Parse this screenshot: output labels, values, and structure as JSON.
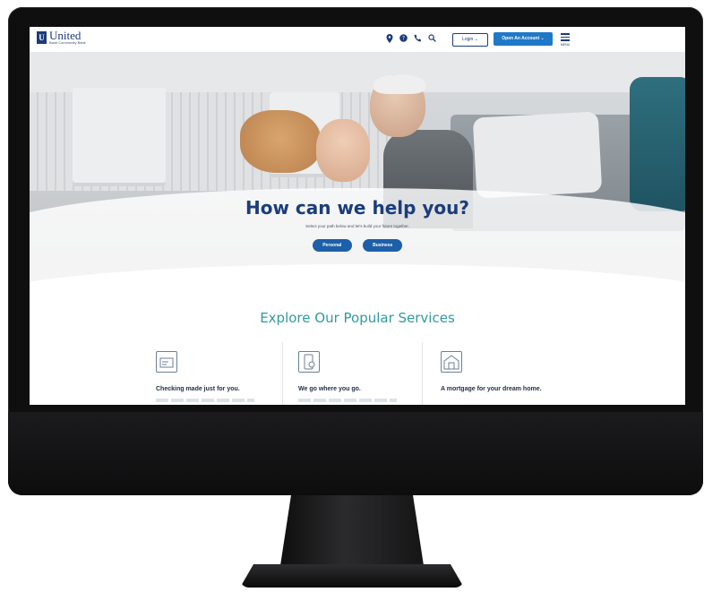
{
  "header": {
    "logo_name": "United",
    "logo_tagline": "Bank  Community Bank",
    "icons": [
      "location-icon",
      "help-icon",
      "phone-icon",
      "search-icon"
    ],
    "login_label": "Login ⌄",
    "open_account_label": "Open An Account ⌄",
    "menu_label": "MENU"
  },
  "hero": {
    "title": "How can we help you?",
    "subtitle": "Select your path below and let's build your future together.",
    "buttons": [
      {
        "label": "Personal"
      },
      {
        "label": "Business"
      }
    ]
  },
  "services": {
    "title": "Explore Our Popular Services",
    "items": [
      {
        "title": "Checking made just for you.",
        "icon": "checking-icon"
      },
      {
        "title": "We go where you go.",
        "icon": "mobile-icon"
      },
      {
        "title": "A mortgage for your dream home.",
        "icon": "home-icon"
      }
    ]
  },
  "colors": {
    "brand_navy": "#1d3a7a",
    "accent_blue": "#1f78c8",
    "teal_heading": "#2e9aa3"
  }
}
